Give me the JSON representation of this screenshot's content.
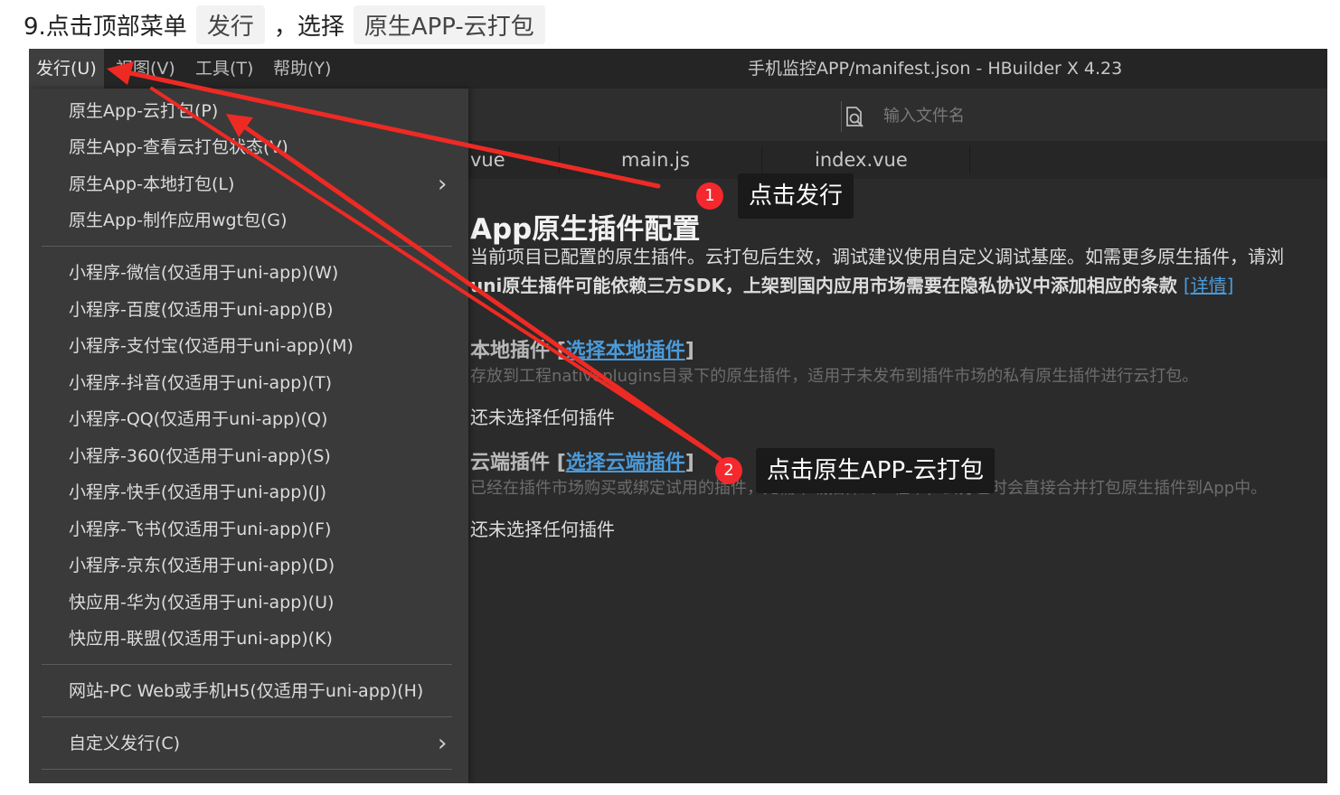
{
  "instruction": {
    "step_text": "9.点击顶部菜单",
    "code1": "发行",
    "sep_text": "，选择",
    "code2": "原生APP-云打包"
  },
  "window": {
    "title": "手机监控APP/manifest.json - HBuilder X 4.23",
    "menubar": [
      "发行(U)",
      "视图(V)",
      "工具(T)",
      "帮助(Y)"
    ],
    "file_search_placeholder": "输入文件名"
  },
  "tabs": [
    "vue",
    "main.js",
    "index.vue"
  ],
  "page": {
    "heading": "App原生插件配置",
    "desc1": "当前项目已配置的原生插件。云打包后生效，调试建议使用自定义调试基座。如需更多原生插件，请浏",
    "desc2": "uni原生插件可能依赖三方SDK，上架到国内应用市场需要在隐私协议中添加相应的条款",
    "desc2_link": "[详情]",
    "local": {
      "title": "本地插件",
      "link": "选择本地插件",
      "desc": "存放到工程nativeplugins目录下的原生插件，适用于未发布到插件市场的私有原生插件进行云打包。",
      "empty": "还未选择任何插件"
    },
    "cloud": {
      "title": "云端插件",
      "link": "选择云端插件",
      "desc": "已经在插件市场购买或绑定试用的插件，无需下载插件到工程中，云打包时会直接合并打包原生插件到App中。",
      "empty": "还未选择任何插件"
    }
  },
  "menu": {
    "items": [
      "原生App-云打包(P)",
      "原生App-查看云打包状态(V)",
      "原生App-本地打包(L)",
      "原生App-制作应用wgt包(G)",
      "小程序-微信(仅适用于uni-app)(W)",
      "小程序-百度(仅适用于uni-app)(B)",
      "小程序-支付宝(仅适用于uni-app)(M)",
      "小程序-抖音(仅适用于uni-app)(T)",
      "小程序-QQ(仅适用于uni-app)(Q)",
      "小程序-360(仅适用于uni-app)(S)",
      "小程序-快手(仅适用于uni-app)(J)",
      "小程序-飞书(仅适用于uni-app)(F)",
      "小程序-京东(仅适用于uni-app)(D)",
      "快应用-华为(仅适用于uni-app)(U)",
      "快应用-联盟(仅适用于uni-app)(K)",
      "网站-PC Web或手机H5(仅适用于uni-app)(H)",
      "自定义发行(C)"
    ],
    "submenu_glyph": "›"
  },
  "annotations": [
    {
      "number": "1",
      "text": "点击发行"
    },
    {
      "number": "2",
      "text": "点击原生APP-云打包"
    }
  ],
  "colors": {
    "arrow": "#ee2a24",
    "badge": "#f5282d",
    "link": "#4b9ad9"
  }
}
